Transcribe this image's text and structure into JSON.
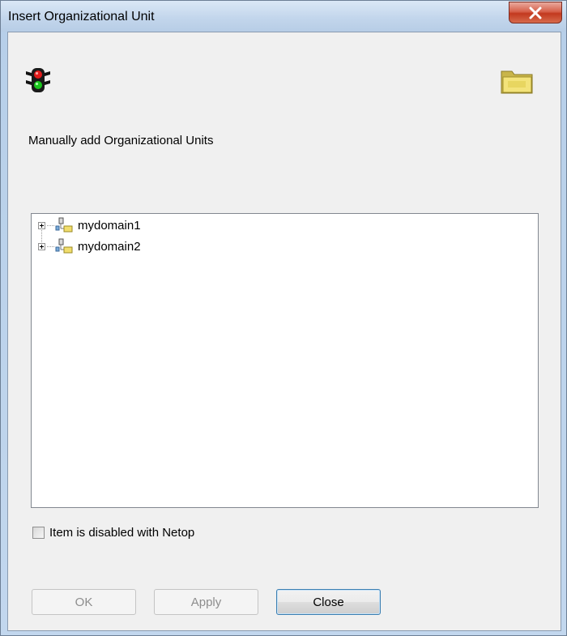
{
  "window": {
    "title": "Insert Organizational Unit",
    "close_glyph": "X"
  },
  "icons": {
    "status": "traffic-light-icon",
    "browse": "folder-icon"
  },
  "description": "Manually add Organizational Units",
  "tree": {
    "items": [
      {
        "label": "mydomain1",
        "icon": "domain-icon",
        "expanded": false
      },
      {
        "label": "mydomain2",
        "icon": "domain-icon",
        "expanded": false
      }
    ]
  },
  "checkbox": {
    "label": "Item is disabled with Netop",
    "checked": false
  },
  "buttons": {
    "ok": {
      "label": "OK",
      "enabled": false
    },
    "apply": {
      "label": "Apply",
      "enabled": false
    },
    "close": {
      "label": "Close",
      "enabled": true
    }
  },
  "colors": {
    "close_button": "#c2391f",
    "titlebar": "#c3d6ec",
    "dialog_face": "#f0f0f0"
  }
}
